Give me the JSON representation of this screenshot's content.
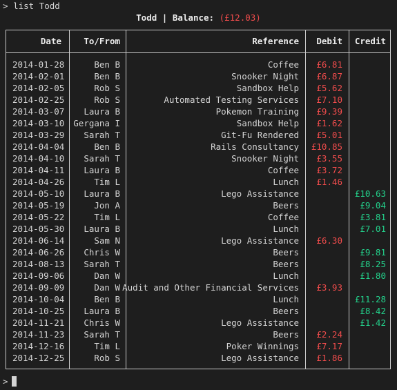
{
  "command": {
    "prompt": ">",
    "text": "list Todd"
  },
  "summary": {
    "name": "Todd",
    "separator": "|",
    "balance_label": "Balance:",
    "balance_value": "(£12.03)"
  },
  "table": {
    "headers": {
      "date": "Date",
      "to_from": "To/From",
      "reference": "Reference",
      "debit": "Debit",
      "credit": "Credit"
    },
    "rows": [
      {
        "date": "2014-01-28",
        "to_from": "Ben B",
        "reference": "Coffee",
        "debit": "£6.81",
        "credit": ""
      },
      {
        "date": "2014-02-01",
        "to_from": "Ben B",
        "reference": "Snooker Night",
        "debit": "£6.87",
        "credit": ""
      },
      {
        "date": "2014-02-05",
        "to_from": "Rob S",
        "reference": "Sandbox Help",
        "debit": "£5.62",
        "credit": ""
      },
      {
        "date": "2014-02-25",
        "to_from": "Rob S",
        "reference": "Automated Testing Services",
        "debit": "£7.10",
        "credit": ""
      },
      {
        "date": "2014-03-07",
        "to_from": "Laura B",
        "reference": "Pokemon Training",
        "debit": "£9.39",
        "credit": ""
      },
      {
        "date": "2014-03-10",
        "to_from": "Gergana I",
        "reference": "Sandbox Help",
        "debit": "£1.62",
        "credit": ""
      },
      {
        "date": "2014-03-29",
        "to_from": "Sarah T",
        "reference": "Git-Fu Rendered",
        "debit": "£5.01",
        "credit": ""
      },
      {
        "date": "2014-04-04",
        "to_from": "Ben B",
        "reference": "Rails Consultancy",
        "debit": "£10.85",
        "credit": ""
      },
      {
        "date": "2014-04-10",
        "to_from": "Sarah T",
        "reference": "Snooker Night",
        "debit": "£3.55",
        "credit": ""
      },
      {
        "date": "2014-04-11",
        "to_from": "Laura B",
        "reference": "Coffee",
        "debit": "£3.72",
        "credit": ""
      },
      {
        "date": "2014-04-26",
        "to_from": "Tim L",
        "reference": "Lunch",
        "debit": "£1.46",
        "credit": ""
      },
      {
        "date": "2014-05-10",
        "to_from": "Laura B",
        "reference": "Lego Assistance",
        "debit": "",
        "credit": "£10.63"
      },
      {
        "date": "2014-05-19",
        "to_from": "Jon A",
        "reference": "Beers",
        "debit": "",
        "credit": "£9.04"
      },
      {
        "date": "2014-05-22",
        "to_from": "Tim L",
        "reference": "Coffee",
        "debit": "",
        "credit": "£3.81"
      },
      {
        "date": "2014-05-30",
        "to_from": "Laura B",
        "reference": "Lunch",
        "debit": "",
        "credit": "£7.01"
      },
      {
        "date": "2014-06-14",
        "to_from": "Sam N",
        "reference": "Lego Assistance",
        "debit": "£6.30",
        "credit": ""
      },
      {
        "date": "2014-06-26",
        "to_from": "Chris W",
        "reference": "Beers",
        "debit": "",
        "credit": "£9.81"
      },
      {
        "date": "2014-08-13",
        "to_from": "Sarah T",
        "reference": "Beers",
        "debit": "",
        "credit": "£8.25"
      },
      {
        "date": "2014-09-06",
        "to_from": "Dan W",
        "reference": "Lunch",
        "debit": "",
        "credit": "£1.80"
      },
      {
        "date": "2014-09-09",
        "to_from": "Dan W",
        "reference": "Audit and Other Financial Services",
        "debit": "£3.93",
        "credit": ""
      },
      {
        "date": "2014-10-04",
        "to_from": "Ben B",
        "reference": "Lunch",
        "debit": "",
        "credit": "£11.28"
      },
      {
        "date": "2014-10-25",
        "to_from": "Laura B",
        "reference": "Beers",
        "debit": "",
        "credit": "£8.42"
      },
      {
        "date": "2014-11-21",
        "to_from": "Chris W",
        "reference": "Lego Assistance",
        "debit": "",
        "credit": "£1.42"
      },
      {
        "date": "2014-11-23",
        "to_from": "Sarah T",
        "reference": "Beers",
        "debit": "£2.24",
        "credit": ""
      },
      {
        "date": "2014-12-16",
        "to_from": "Tim L",
        "reference": "Poker Winnings",
        "debit": "£7.17",
        "credit": ""
      },
      {
        "date": "2014-12-25",
        "to_from": "Rob S",
        "reference": "Lego Assistance",
        "debit": "£1.86",
        "credit": ""
      }
    ]
  },
  "input_prompt": {
    "symbol": ">",
    "value": ""
  },
  "colors": {
    "background": "#1e1e1e",
    "text": "#d4d4d4",
    "debit": "#f14c4c",
    "credit": "#23d18b",
    "border": "#cccccc"
  }
}
